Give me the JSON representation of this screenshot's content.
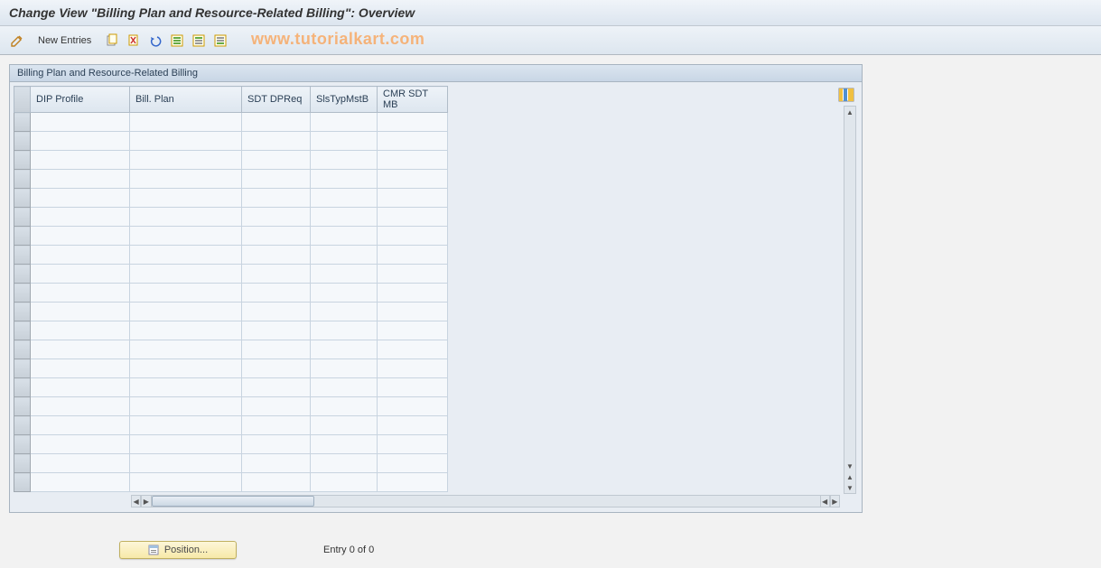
{
  "header": {
    "title": "Change View \"Billing Plan and Resource-Related Billing\": Overview"
  },
  "toolbar": {
    "new_entries_label": "New Entries"
  },
  "watermark": "www.tutorialkart.com",
  "panel": {
    "title": "Billing Plan and Resource-Related Billing",
    "columns": {
      "dip": "DIP Profile",
      "bill": "Bill. Plan",
      "sdt": "SDT DPReq",
      "sls": "SlsTypMstB",
      "cmr": "CMR SDT MB"
    }
  },
  "footer": {
    "position_label": "Position...",
    "entry_text": "Entry 0 of 0"
  }
}
